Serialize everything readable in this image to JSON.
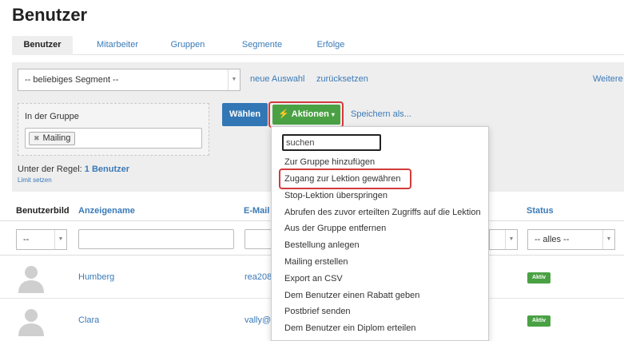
{
  "page": {
    "title": "Benutzer"
  },
  "tabs": [
    {
      "label": "Benutzer"
    },
    {
      "label": "Mitarbeiter"
    },
    {
      "label": "Gruppen"
    },
    {
      "label": "Segmente"
    },
    {
      "label": "Erfolge"
    }
  ],
  "toolbar": {
    "segment_select": "-- beliebiges Segment --",
    "new_selection": "neue Auswahl",
    "reset": "zurücksetzen",
    "more": "Weitere"
  },
  "group_filter": {
    "label": "In der Gruppe",
    "tag": "Mailing"
  },
  "buttons": {
    "select": "Wählen",
    "actions": "Aktionen",
    "save_as": "Speichern als..."
  },
  "rule": {
    "prefix": "Unter der Regel:",
    "count": "1 Benutzer",
    "limit": "Limit setzen"
  },
  "table": {
    "headers": {
      "picture": "Benutzerbild",
      "display_name": "Anzeigename",
      "email": "E-Mail",
      "status": "Status"
    },
    "filters": {
      "picture": "--",
      "status": "-- alles --"
    },
    "rows": [
      {
        "name": "Humberg",
        "email": "rea208",
        "status": "Aktiv"
      },
      {
        "name": "Clara",
        "email": "vally@y",
        "status": "Aktiv"
      }
    ]
  },
  "dropdown": {
    "search_placeholder": "suchen",
    "items": [
      "Zur Gruppe hinzufügen",
      "Zugang zur Lektion gewähren",
      "Stop-Lektion überspringen",
      "Abrufen des zuvor erteilten Zugriffs auf die Lektion",
      "Aus der Gruppe entfernen",
      "Bestellung anlegen",
      "Mailing erstellen",
      "Export an CSV",
      "Dem Benutzer einen Rabatt geben",
      "Postbrief senden",
      "Dem Benutzer ein Diplom erteilen"
    ]
  },
  "colors": {
    "link": "#3a7ab8",
    "primary_button": "#3177b5",
    "action_button": "#4aa144",
    "highlight_outline": "#d23b3b",
    "active_badge": "#4aa144"
  }
}
